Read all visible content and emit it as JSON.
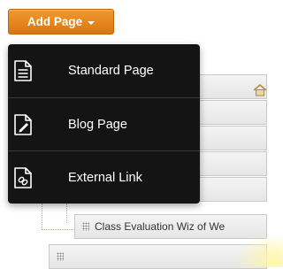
{
  "toolbar": {
    "add_page_label": "Add Page"
  },
  "menu": {
    "items": [
      {
        "label": "Standard Page",
        "icon": "document-lines-icon"
      },
      {
        "label": "Blog Page",
        "icon": "document-pencil-icon"
      },
      {
        "label": "External Link",
        "icon": "document-link-icon"
      }
    ]
  },
  "tree": {
    "visible_row_label": "Class Evaluation Wiz of We"
  },
  "colors": {
    "button_orange": "#e8851f",
    "menu_bg": "#141414",
    "tree_row_bg": "#ececec"
  }
}
